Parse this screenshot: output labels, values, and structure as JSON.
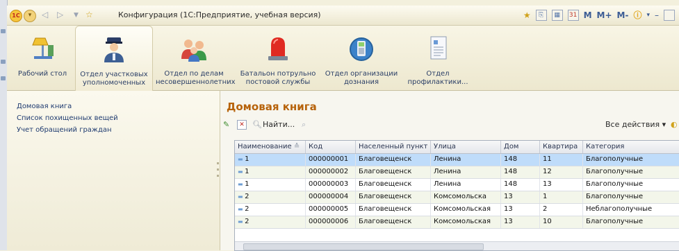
{
  "window": {
    "title": "Конфигурация  (1С:Предприятие, учебная версия)",
    "logo": "1С",
    "right_tools": [
      "M",
      "M+",
      "M-"
    ]
  },
  "sections": [
    {
      "label": "Рабочий стол",
      "icon": "desk-lamp-icon",
      "active": false
    },
    {
      "label": "Отдел участковых уполномоченных",
      "icon": "police-officer-icon",
      "active": true
    },
    {
      "label": "Отдел по делам несовершеннолетних",
      "icon": "children-icon",
      "active": false
    },
    {
      "label": "Батальон потрульно постовой службы",
      "icon": "siren-icon",
      "active": false
    },
    {
      "label": "Отдел организации дознания",
      "icon": "phone-icon",
      "active": false
    },
    {
      "label": "Отдел профилактики...",
      "icon": "document-icon",
      "active": false
    }
  ],
  "left_nav": {
    "items": [
      {
        "label": "Домовая книга"
      },
      {
        "label": "Список похищенных вещей"
      },
      {
        "label": "Учет обращений граждан"
      }
    ]
  },
  "form": {
    "title": "Домовая книга",
    "find_label": "Найти...",
    "all_actions_label": "Все действия ▾"
  },
  "table": {
    "columns": [
      "Наименование",
      "Код",
      "Населенный пункт",
      "Улица",
      "Дом",
      "Квартира",
      "Категория"
    ],
    "rows": [
      [
        "1",
        "000000001",
        "Благовещенск",
        "Ленина",
        "148",
        "11",
        "Благополучные"
      ],
      [
        "1",
        "000000002",
        "Благовещенск",
        "Ленина",
        "148",
        "12",
        "Благополучные"
      ],
      [
        "1",
        "000000003",
        "Благовещенск",
        "Ленина",
        "148",
        "13",
        "Благополучные"
      ],
      [
        "2",
        "000000004",
        "Благовещенск",
        "Комсомольска",
        "13",
        "1",
        "Благополучные"
      ],
      [
        "2",
        "000000005",
        "Благовещенск",
        "Комсомольская",
        "13",
        "2",
        "Неблагополучные"
      ],
      [
        "2",
        "000000006",
        "Благовещенск",
        "Комсомольская",
        "13",
        "10",
        "Благополучные"
      ]
    ],
    "selected_row": 0
  },
  "colors": {
    "accent_title": "#b7630c",
    "selection": "#bfdcfa",
    "panel_bg": "#f3f0dd"
  }
}
